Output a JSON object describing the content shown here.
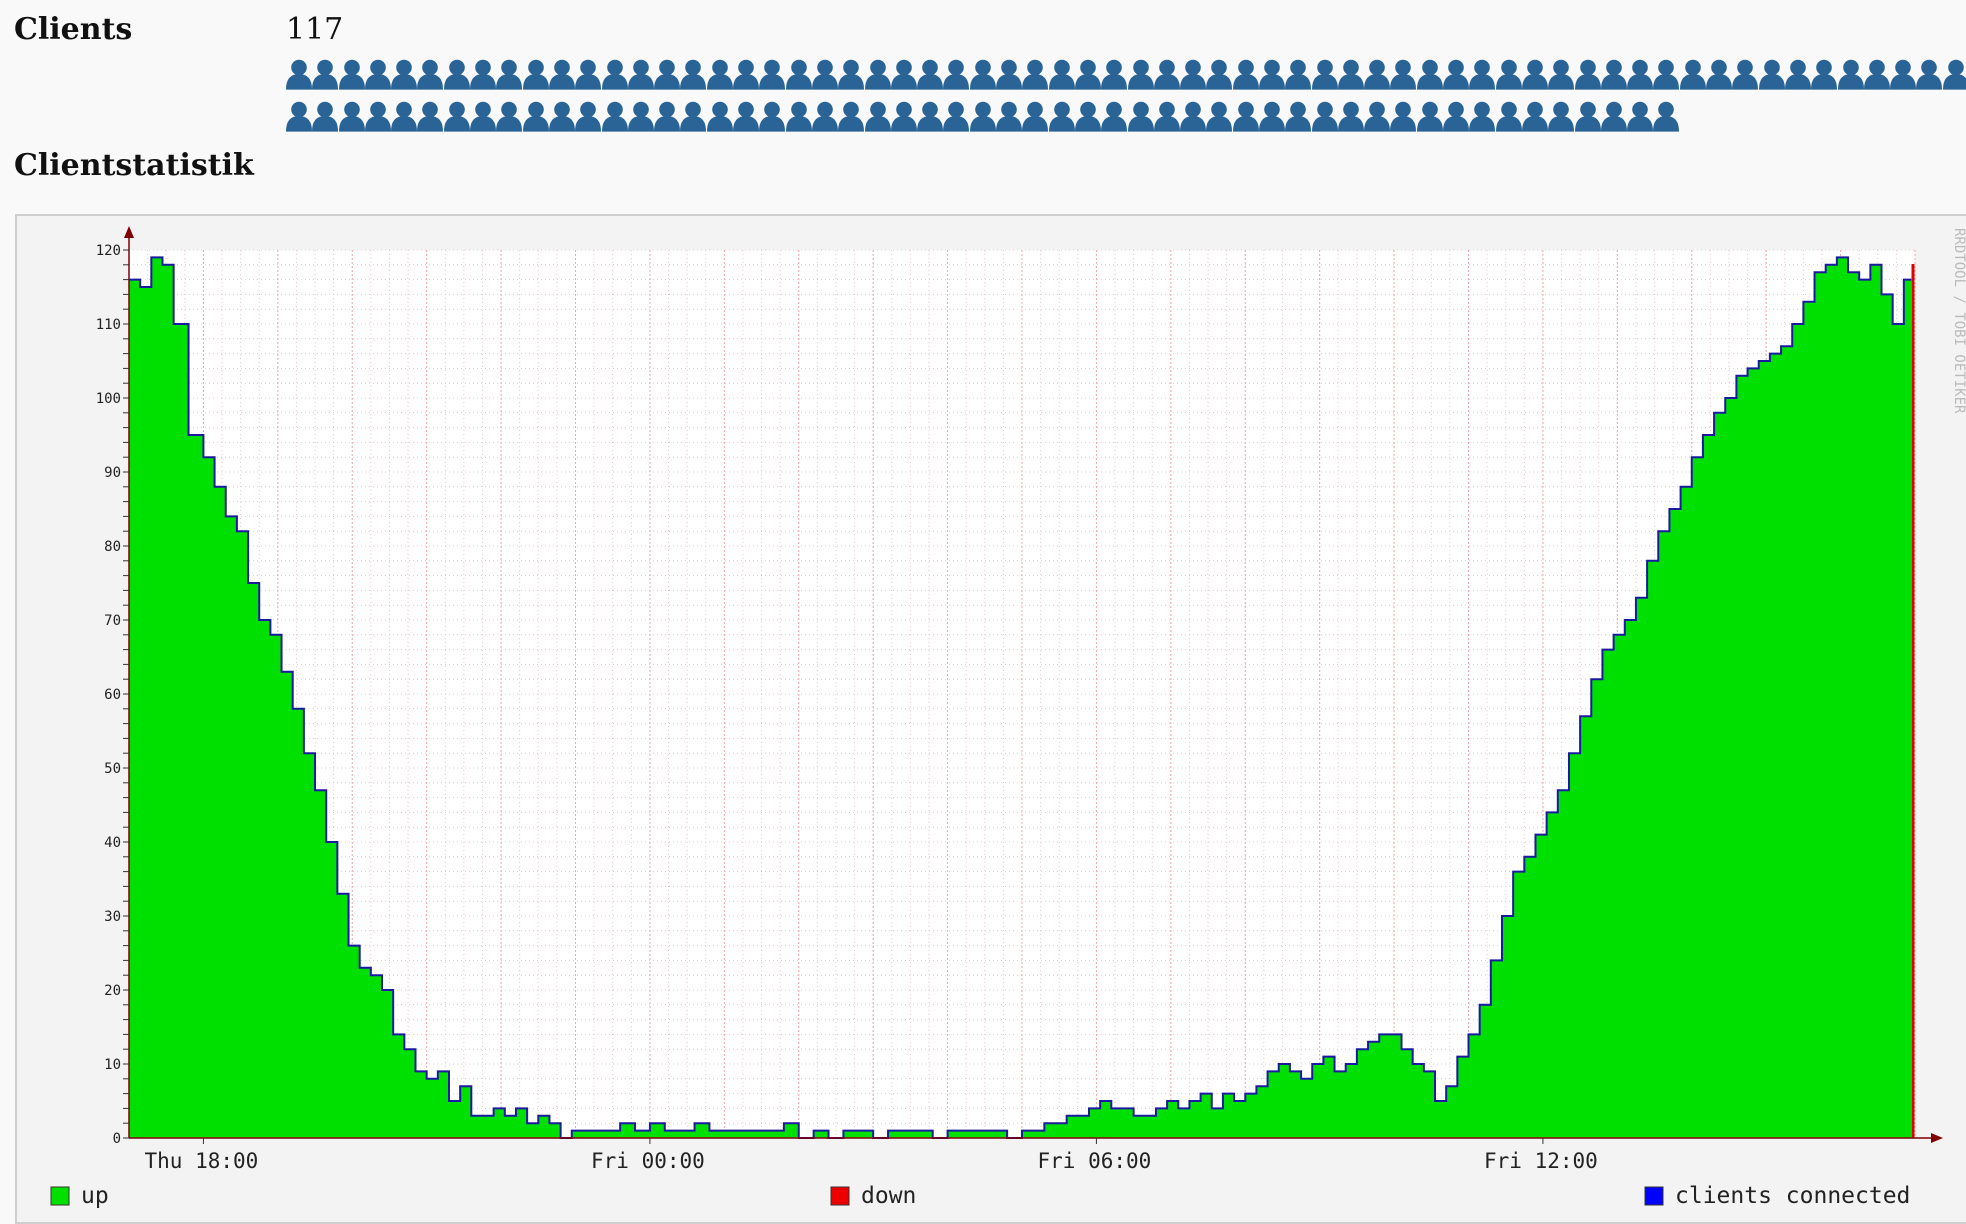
{
  "clients": {
    "label": "Clients",
    "count": "117",
    "icon_color": "#2a6496",
    "icon_name": "person-icon",
    "icons_row1": 64,
    "icons_row2": 53
  },
  "stats": {
    "heading": "Clientstatistik"
  },
  "chart_data": {
    "type": "area",
    "title": "",
    "xlabel": "",
    "ylabel": "",
    "watermark": "RRDTOOL / TOBI OETIKER",
    "ylim": [
      0,
      120
    ],
    "x_tick_labels": [
      "Thu 18:00",
      "Fri 00:00",
      "Fri 06:00",
      "Fri 12:00"
    ],
    "x_tick_hours": [
      1,
      7,
      13,
      19
    ],
    "x_hours_range": [
      0,
      24
    ],
    "grid": true,
    "legend_position": "bottom",
    "legend": [
      {
        "name": "up",
        "color": "#00e000"
      },
      {
        "name": "down",
        "color": "#ee0000"
      },
      {
        "name": "clients connected",
        "color": "#0000ff"
      }
    ],
    "series": [
      {
        "name": "clients connected",
        "color": "#00e000",
        "line_color": "#1a1aa0",
        "x_hours": [
          0,
          0.15,
          0.3,
          0.45,
          0.6,
          0.8,
          1.0,
          1.15,
          1.3,
          1.45,
          1.6,
          1.75,
          1.9,
          2.05,
          2.2,
          2.35,
          2.5,
          2.65,
          2.8,
          2.95,
          3.1,
          3.25,
          3.4,
          3.55,
          3.7,
          3.85,
          4.0,
          4.15,
          4.3,
          4.45,
          4.6,
          4.75,
          4.9,
          5.05,
          5.2,
          5.35,
          5.5,
          5.65,
          5.8,
          5.95,
          6.1,
          6.25,
          6.4,
          6.6,
          6.8,
          7.0,
          7.2,
          7.4,
          7.6,
          7.8,
          8.0,
          8.2,
          8.4,
          8.6,
          8.8,
          9.0,
          9.2,
          9.4,
          9.6,
          9.8,
          10.0,
          10.2,
          10.4,
          10.6,
          10.8,
          11.0,
          11.2,
          11.4,
          11.6,
          11.8,
          12.0,
          12.15,
          12.3,
          12.45,
          12.6,
          12.75,
          12.9,
          13.05,
          13.2,
          13.35,
          13.5,
          13.65,
          13.8,
          13.95,
          14.1,
          14.25,
          14.4,
          14.55,
          14.7,
          14.85,
          15.0,
          15.15,
          15.3,
          15.45,
          15.6,
          15.75,
          15.9,
          16.05,
          16.2,
          16.35,
          16.5,
          16.65,
          16.8,
          16.95,
          17.1,
          17.25,
          17.4,
          17.55,
          17.7,
          17.85,
          18.0,
          18.15,
          18.3,
          18.45,
          18.6,
          18.75,
          18.9,
          19.05,
          19.2,
          19.35,
          19.5,
          19.65,
          19.8,
          19.95,
          20.1,
          20.25,
          20.4,
          20.55,
          20.7,
          20.85,
          21.0,
          21.15,
          21.3,
          21.45,
          21.6,
          21.75,
          21.9,
          22.05,
          22.2,
          22.35,
          22.5,
          22.65,
          22.8,
          22.95,
          23.1,
          23.25,
          23.4,
          23.55,
          23.7,
          23.85,
          23.95
        ],
        "values": [
          116,
          115,
          119,
          118,
          110,
          95,
          92,
          88,
          84,
          82,
          75,
          70,
          68,
          63,
          58,
          52,
          47,
          40,
          33,
          26,
          23,
          22,
          20,
          14,
          12,
          9,
          8,
          9,
          5,
          7,
          3,
          3,
          4,
          3,
          4,
          2,
          3,
          2,
          0,
          1,
          1,
          1,
          1,
          2,
          1,
          2,
          1,
          1,
          2,
          1,
          1,
          1,
          1,
          1,
          2,
          0,
          1,
          0,
          1,
          1,
          0,
          1,
          1,
          1,
          0,
          1,
          1,
          1,
          1,
          0,
          1,
          1,
          2,
          2,
          3,
          3,
          4,
          5,
          4,
          4,
          3,
          3,
          4,
          5,
          4,
          5,
          6,
          4,
          6,
          5,
          6,
          7,
          9,
          10,
          9,
          8,
          10,
          11,
          9,
          10,
          12,
          13,
          14,
          14,
          12,
          10,
          9,
          5,
          7,
          11,
          14,
          18,
          24,
          30,
          36,
          38,
          41,
          44,
          47,
          52,
          57,
          62,
          66,
          68,
          70,
          73,
          78,
          82,
          85,
          88,
          92,
          95,
          98,
          100,
          103,
          104,
          105,
          106,
          107,
          110,
          113,
          117,
          118,
          119,
          117,
          116,
          118,
          114,
          110,
          116
        ],
        "current_value": 117
      }
    ]
  }
}
